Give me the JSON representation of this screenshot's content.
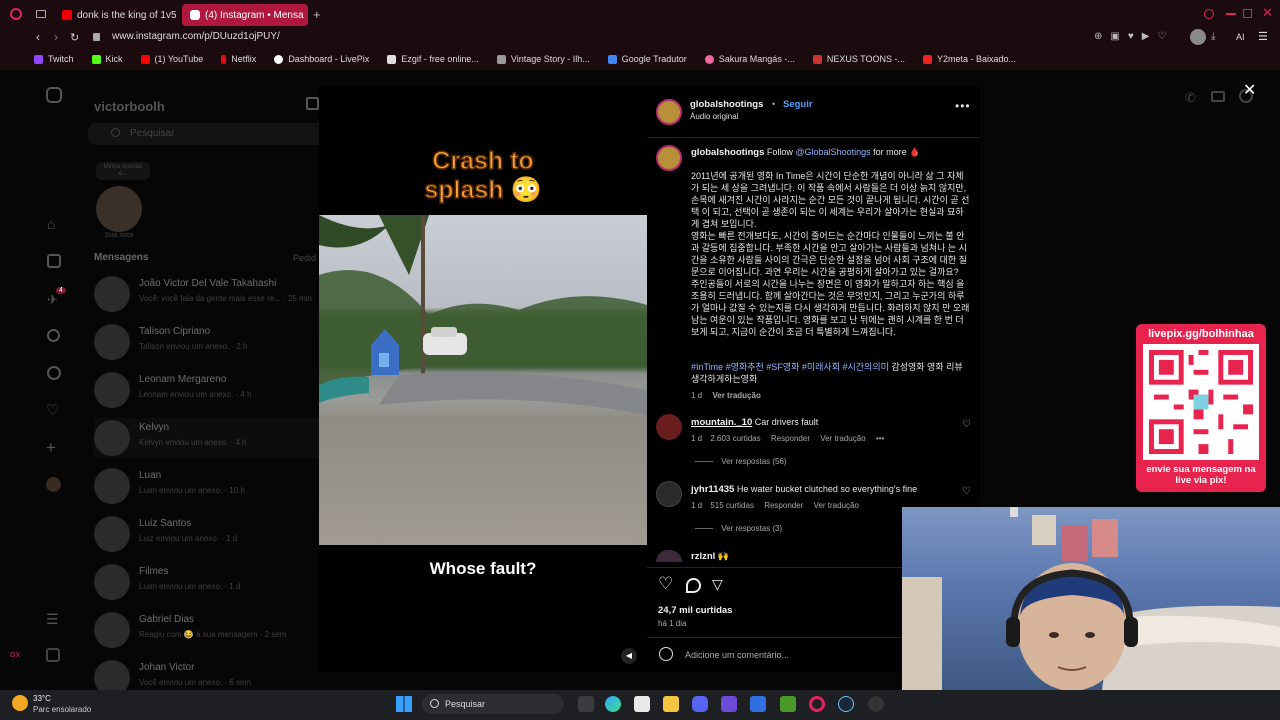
{
  "browser": {
    "tabs": [
      {
        "label": "donk is the king of 1v5 clu"
      },
      {
        "label": "(4) Instagram • Mensa"
      }
    ],
    "url": "www.instagram.com/p/DUuzd1ojPUY/",
    "bookmarks": [
      "Twitch",
      "Kick",
      "(1) YouTube",
      "Netflix",
      "Dashboard - LivePix",
      "Ezgif - free online...",
      "Vintage Story - Ilh...",
      "Google Tradutor",
      "Sakura Mangás -...",
      "NEXUS TOONS -...",
      "Y2meta - Baixado..."
    ],
    "ai_label": "AI"
  },
  "colors": {
    "accent": "#e0245e",
    "link": "#8fb4ff",
    "seguir": "#4a9eff",
    "livepix": "#e8244e"
  },
  "messages_sidebar": {
    "username": "victorboolh",
    "search_placeholder": "Pesquisar",
    "note_bubble": "Minha ocasião é...",
    "note_label": "Sua nota",
    "section_title": "Mensagens",
    "requests_label": "Pedid",
    "conversations": [
      {
        "name": "João Victor Del Vale Takahashi",
        "preview": "Você: você fala da gente mais esse re... · 25 min"
      },
      {
        "name": "Talison Cipriano",
        "preview": "Talison enviou um anexo. · 2 h"
      },
      {
        "name": "Leonam Mergareno",
        "preview": "Leonam enviou um anexo. · 4 h"
      },
      {
        "name": "Kelvyn",
        "preview": "Kelvyn enviou um anexo. · 4 h"
      },
      {
        "name": "Luan",
        "preview": "Luan enviou um anexo. · 10 h"
      },
      {
        "name": "Luiz Santos",
        "preview": "Luiz enviou um anexo. · 1 d"
      },
      {
        "name": "Filmes",
        "preview": "Luan enviou um anexo. · 1 d"
      },
      {
        "name": "Gabriel Dias",
        "preview": "Reagiu com 😂 à sua mensagem · 2 sem"
      },
      {
        "name": "Johan Victor",
        "preview": "Você enviou um anexo. · 6 sem"
      }
    ],
    "badge_count": "4"
  },
  "post": {
    "overlay_title_line1": "Crash to",
    "overlay_title_line2": "splash 😳",
    "overlay_bottom_text": "Whose fault?",
    "author": "globalshootings",
    "follow_label": "Seguir",
    "audio_label": "Áudio original",
    "caption_user": "globalshootings",
    "caption_intro": "Follow",
    "caption_mention": "@GlobalShootings",
    "caption_suffix": "for more 🩸",
    "caption_body": "2011년에 공개된 영화 In Time은 시간이 단순한 개념이 아니라 삶 그 자체가 되는 세 상을 그려냅니다. 이 작품 속에서 사람들은 더 이상 늙지 않지만, 손목에 새겨진 시간이 사라지는 순간 모든 것이 끝나게 됩니다. 시간이 곧 선택 이 되고, 선택이 곧 생존이 되는 이 세계는 우리가 살아가는 현실과 묘하게 겹쳐 보입니다.\n영화는 빠른 전개보다도, 시간이 줄어드는 순간마다 인물들이 느끼는 불 안과 갈등에 집중합니다. 부족한 시간을 안고 살아가는 사람들과 넘쳐나 는 시간을 소유한 사람들 사이의 간극은 단순한 설정을 넘어 사회 구조에 대한 질문으로 이어집니다. 과연 우리는 시간을 공평하게 살아가고 있는 걸까요?\n주인공들이 서로의 시간을 나누는 장면은 이 영화가 말하고자 하는 핵심 을 조용히 드러냅니다. 함께 살아간다는 것은 무엇인지, 그리고 누군가의 하루가 얼마나 값질 수 있는지를 다시 생각하게 만듭니다. 화려하지 않지 만 오래 남는 여운이 있는 작품입니다. 영화를 보고 난 뒤에는 괜히 시계를 한 번 더 보게 되고, 지금이 순간이 조금 더 특별하게 느껴집니다.",
    "caption_hashtags": "#InTime #영화추천 #SF영화 #미래사회 #시간의의미",
    "caption_tail": "감성영화 영화 리뷰 생각하게하는영화",
    "caption_time": "1 d",
    "see_translation": "Ver tradução",
    "comments": [
      {
        "user": "mountain._10",
        "text": "Car drivers fault",
        "time": "1 d",
        "likes": "2.603 curtidas",
        "reply": "Responder",
        "translate": "Ver tradução",
        "replies": "Ver respostas (56)"
      },
      {
        "user": "jyhr11435",
        "text": "He water bucket clutched so everything's fine",
        "time": "1 d",
        "likes": "515 curtidas",
        "reply": "Responder",
        "translate": "Ver tradução",
        "replies": "Ver respostas (3)"
      },
      {
        "user": "rzlznl",
        "text": "🙌"
      }
    ],
    "likes_total": "24,7 mil curtidas",
    "posted_ago": "há 1 dia",
    "comment_placeholder": "Adicione um comentário..."
  },
  "livepix": {
    "url": "livepix.gg/bolhinhaa",
    "cta": "envie sua mensagem na live via pix!"
  },
  "taskbar": {
    "weather_temp": "33°C",
    "weather_desc": "Parc ensolarado",
    "search_label": "Pesquisar"
  }
}
